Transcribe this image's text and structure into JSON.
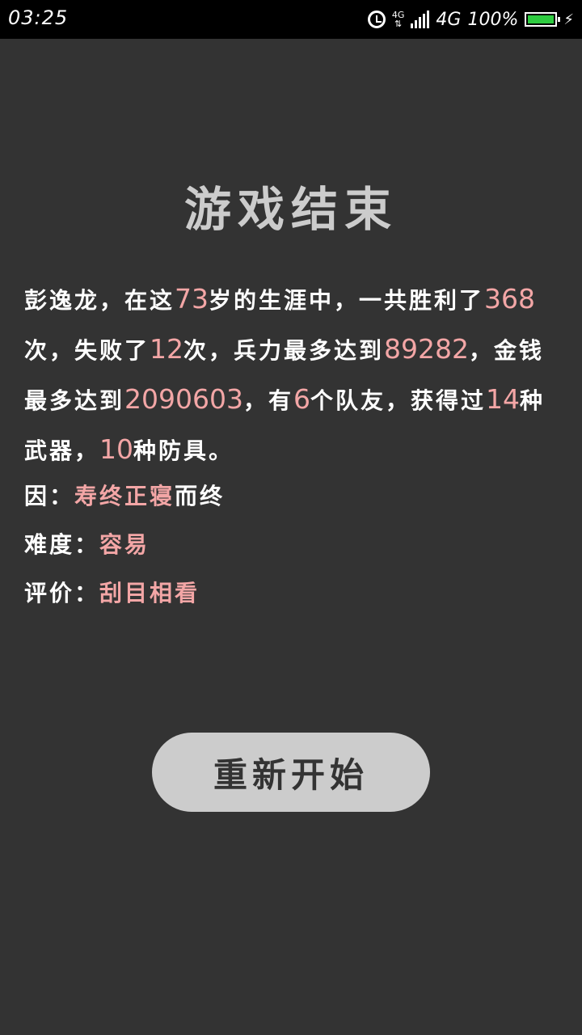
{
  "status_bar": {
    "time": "03:25",
    "network_small": "4G",
    "network": "4G",
    "battery": "100%"
  },
  "title": "游戏结束",
  "summary": {
    "name": "彭逸龙",
    "seg1": "，在这",
    "age": "73",
    "seg2": "岁的生涯中，一共胜利了",
    "wins": "368",
    "seg3": "次，失败了",
    "losses": "12",
    "seg4": "次，兵力最多达到",
    "troops": "89282",
    "seg5": "，金钱最多达到",
    "money": "2090603",
    "seg6": "，有",
    "teammates": "6",
    "seg7": "个队友，获得过",
    "weapons": "14",
    "seg8": "种武器，",
    "armors": "10",
    "seg9": "种防具。"
  },
  "cause": {
    "label": "因：",
    "value": "寿终正寝",
    "suffix": "而终"
  },
  "difficulty": {
    "label": "难度：",
    "value": "容易"
  },
  "rating": {
    "label": "评价：",
    "value": "刮目相看"
  },
  "restart_button": {
    "label": "重新开始"
  },
  "colors": {
    "background": "#333333",
    "highlight": "#f3a6a6",
    "button": "#cccccc"
  }
}
